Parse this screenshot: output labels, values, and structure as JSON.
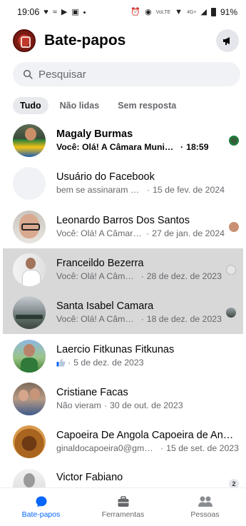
{
  "status_bar": {
    "time": "19:06",
    "network_label_1": "VoLTE",
    "network_label_2": "4G+",
    "battery": "91%"
  },
  "header": {
    "title": "Bate-papos"
  },
  "search": {
    "placeholder": "Pesquisar"
  },
  "tabs": [
    {
      "label": "Tudo",
      "active": true
    },
    {
      "label": "Não lidas",
      "active": false
    },
    {
      "label": "Sem resposta",
      "active": false
    }
  ],
  "chats": [
    {
      "name": "Magaly Burmas",
      "preview": "Você: Olá! A Câmara Municipal de...",
      "time": "18:59",
      "unread": true
    },
    {
      "name": "Usuário do Facebook",
      "preview": "bem se assinaram o aume...",
      "time": "15 de fev. de 2024",
      "unread": false
    },
    {
      "name": "Leonardo Barros Dos Santos",
      "preview": "Você: Olá! A Câmara...",
      "time": "27 de jan. de 2024",
      "unread": false
    },
    {
      "name": "Franceildo Bezerra",
      "preview": "Você: Olá! A Câmara...",
      "time": "28 de dez. de 2023",
      "unread": false,
      "selected": true
    },
    {
      "name": "Santa Isabel Camara",
      "preview": "Você: Olá! A Câmara...",
      "time": "18 de dez. de 2023",
      "unread": false,
      "selected": true
    },
    {
      "name": "Laercio Fitkunas Fitkunas",
      "preview": "",
      "time": "5 de dez. de 2023",
      "unread": false
    },
    {
      "name": "Cristiane Facas",
      "preview": "Não vieram",
      "time": "30 de out. de 2023",
      "unread": false
    },
    {
      "name": "Capoeira De Angola Capoeira de Angola",
      "preview": "ginaldocapoeira0@gmail.c...",
      "time": "15 de set. de 2023",
      "unread": false
    },
    {
      "name": "Victor Fabiano",
      "preview": "",
      "time": "",
      "unread": false,
      "receipt_count": "2"
    }
  ],
  "bottom_nav": [
    {
      "label": "Bate-papos",
      "icon": "chat-bubble-icon",
      "active": true
    },
    {
      "label": "Ferramentas",
      "icon": "briefcase-icon",
      "active": false
    },
    {
      "label": "Pessoas",
      "icon": "people-icon",
      "active": false
    }
  ],
  "colors": {
    "accent": "#0866ff",
    "secondary_text": "#65676b",
    "selected_row": "#d8d8d8"
  }
}
